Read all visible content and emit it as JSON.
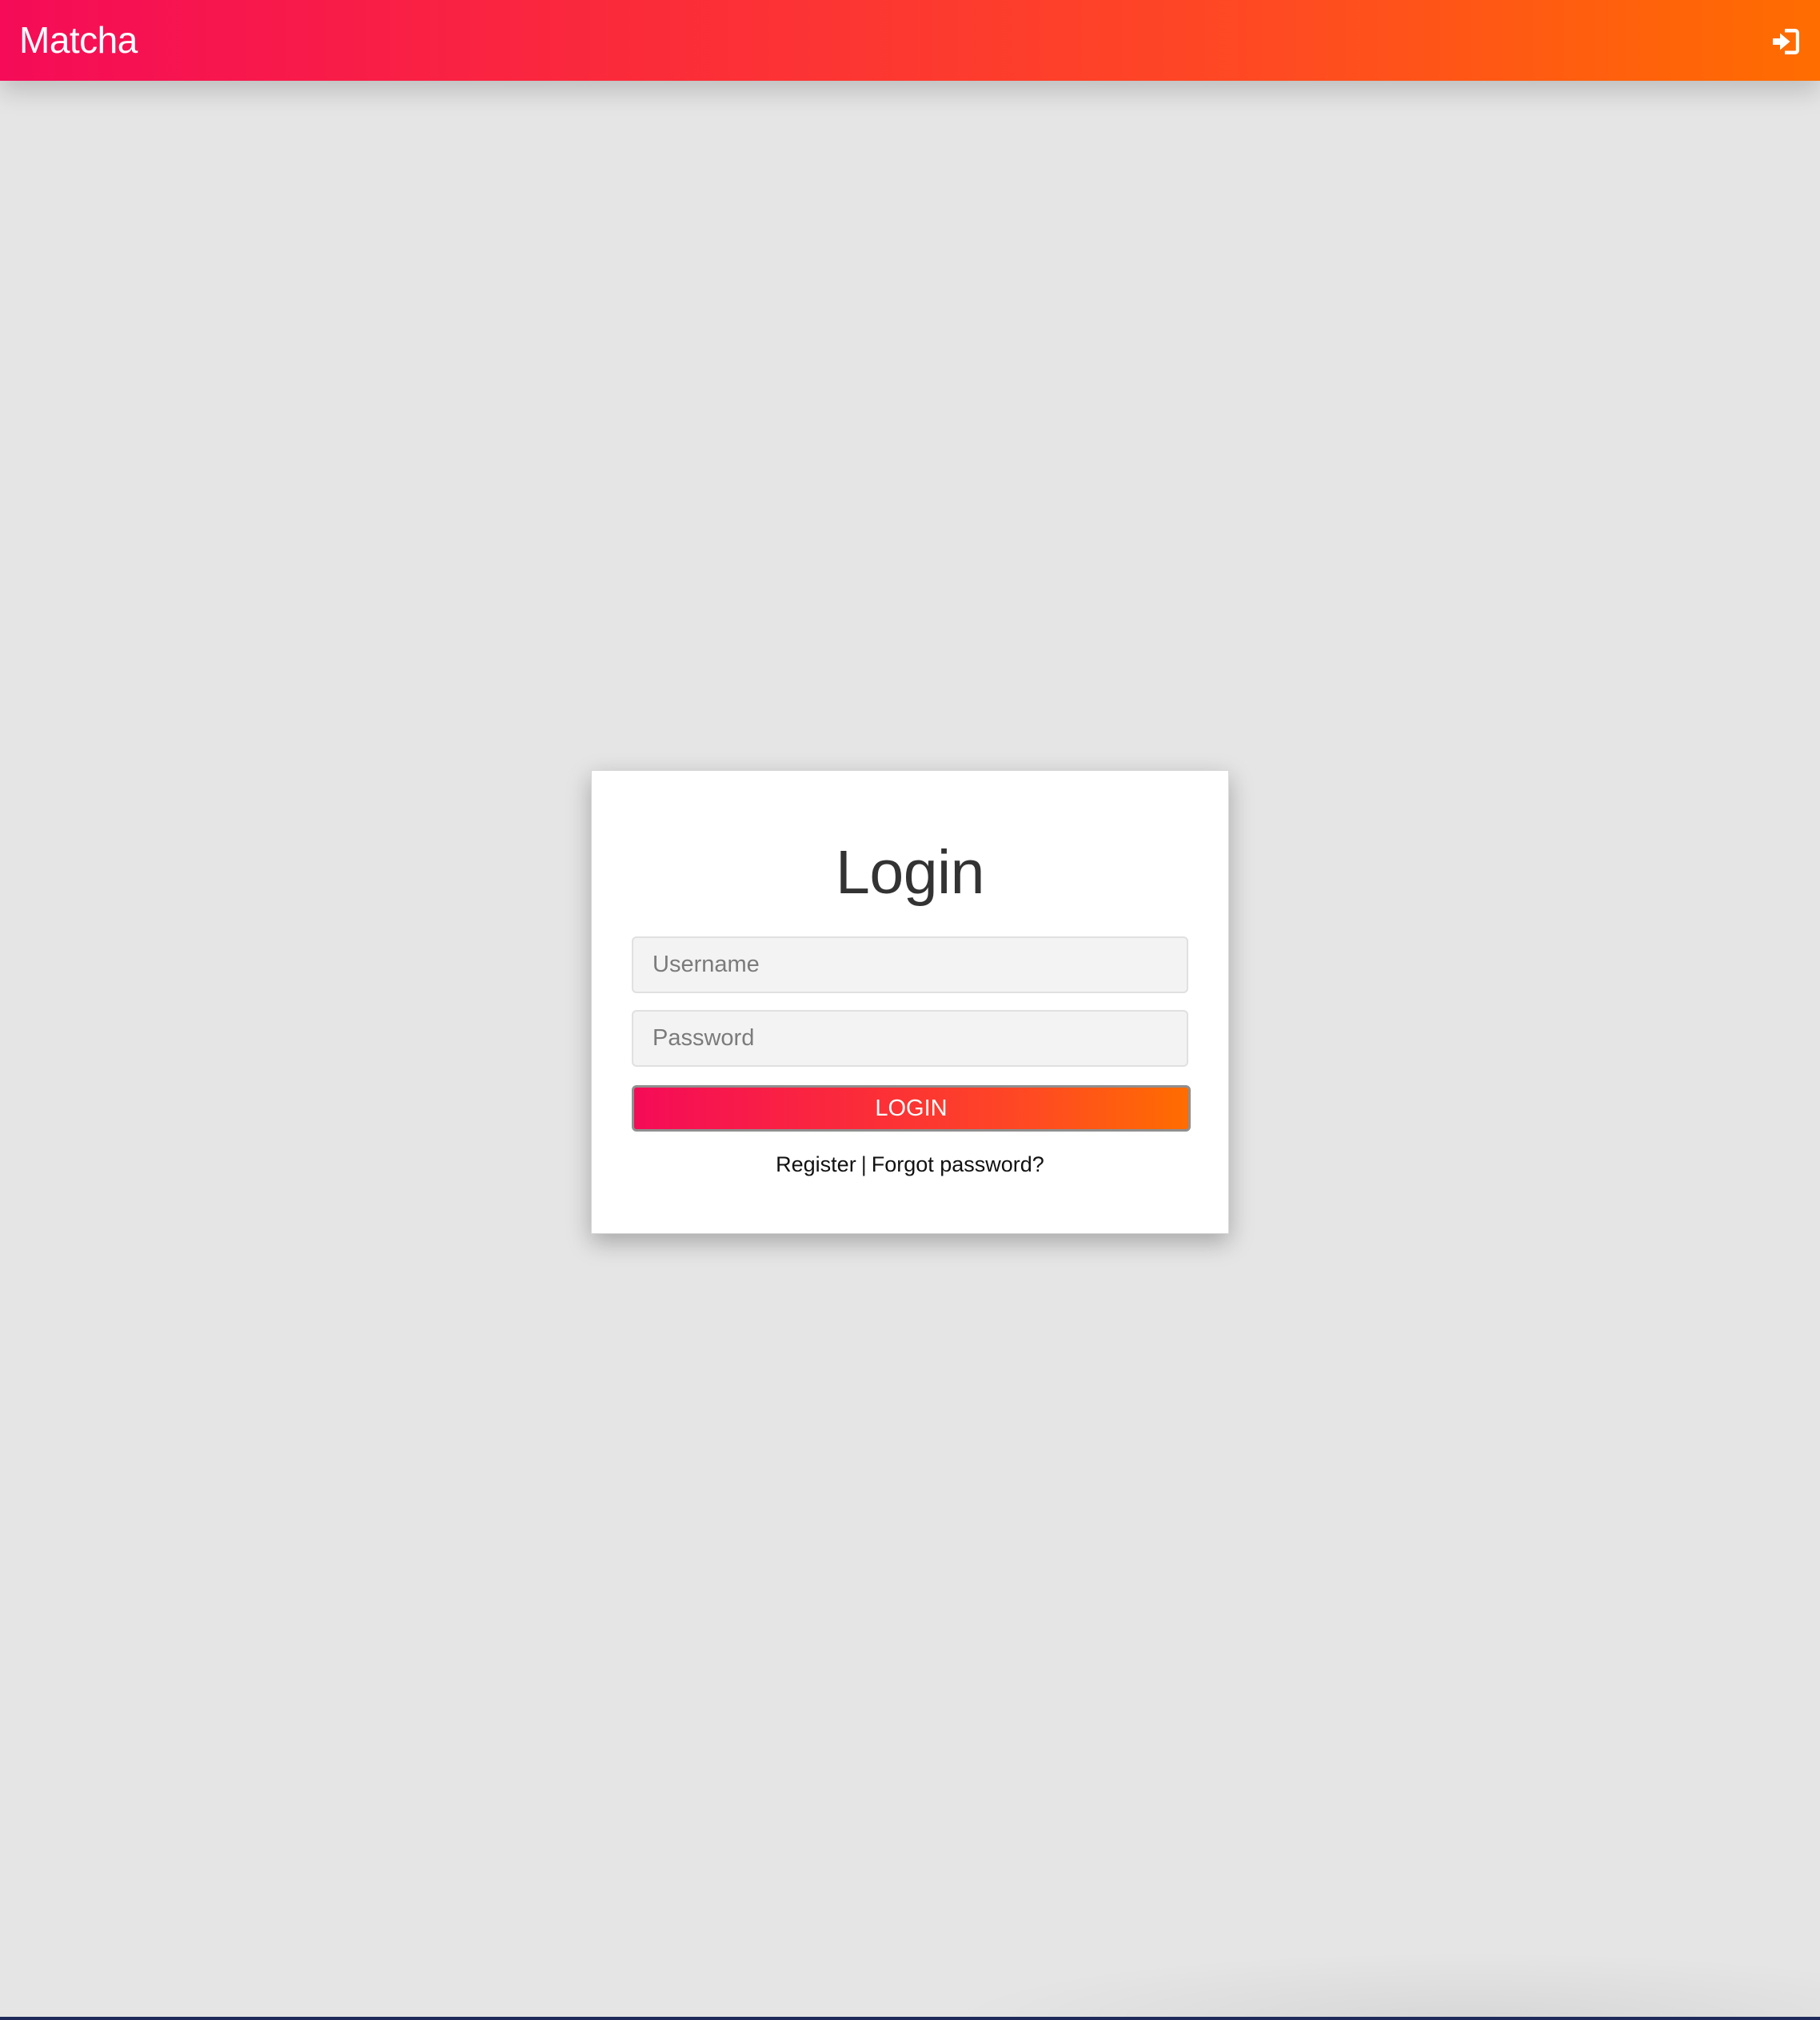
{
  "navbar": {
    "brand": "Matcha",
    "login_icon": "sign-in-icon"
  },
  "login_form": {
    "title": "Login",
    "username_placeholder": "Username",
    "password_placeholder": "Password",
    "submit_label": "LOGIN",
    "register_link": "Register",
    "separator": "|",
    "forgot_link": "Forgot password?"
  },
  "colors": {
    "gradient_start": "#f50b58",
    "gradient_end": "#ff6d00",
    "background": "#e5e5e5",
    "card": "#ffffff",
    "title_text": "#333333"
  }
}
